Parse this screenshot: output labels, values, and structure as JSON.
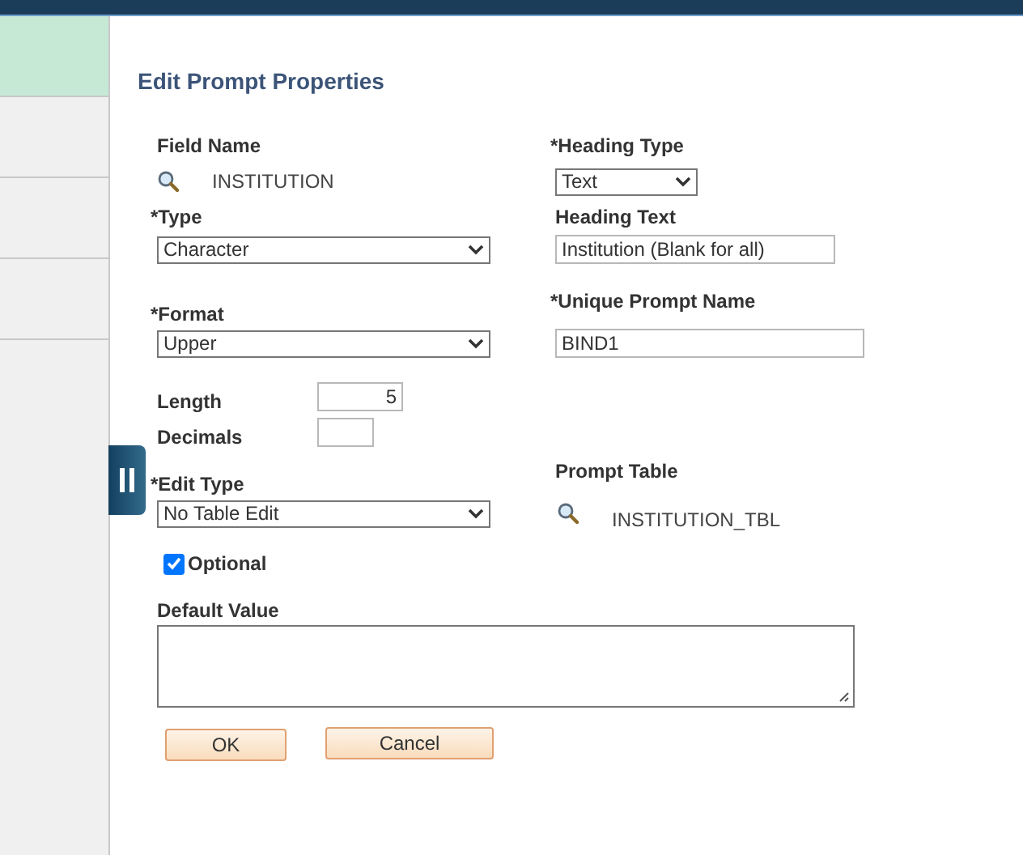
{
  "sidebar": {
    "items": [
      {
        "selected": true
      },
      {
        "selected": false
      },
      {
        "selected": false
      },
      {
        "selected": false
      }
    ]
  },
  "title": "Edit Prompt Properties",
  "field_name": {
    "label": "Field Name",
    "value": "INSTITUTION"
  },
  "heading_type": {
    "label": "*Heading Type",
    "value": "Text"
  },
  "type": {
    "label": "*Type",
    "value": "Character"
  },
  "heading_text": {
    "label": "Heading Text",
    "value": "Institution (Blank for all)"
  },
  "format": {
    "label": "*Format",
    "value": "Upper"
  },
  "unique_prompt_name": {
    "label": "*Unique Prompt Name",
    "value": "BIND1"
  },
  "length": {
    "label": "Length",
    "value": "5"
  },
  "decimals": {
    "label": "Decimals"
  },
  "edit_type": {
    "label": "*Edit Type",
    "value": "No Table Edit"
  },
  "prompt_table": {
    "label": "Prompt Table",
    "value": "INSTITUTION_TBL"
  },
  "optional": {
    "label": "Optional",
    "checked": true
  },
  "default_value": {
    "label": "Default Value"
  },
  "buttons": [
    "OK",
    "Cancel"
  ]
}
